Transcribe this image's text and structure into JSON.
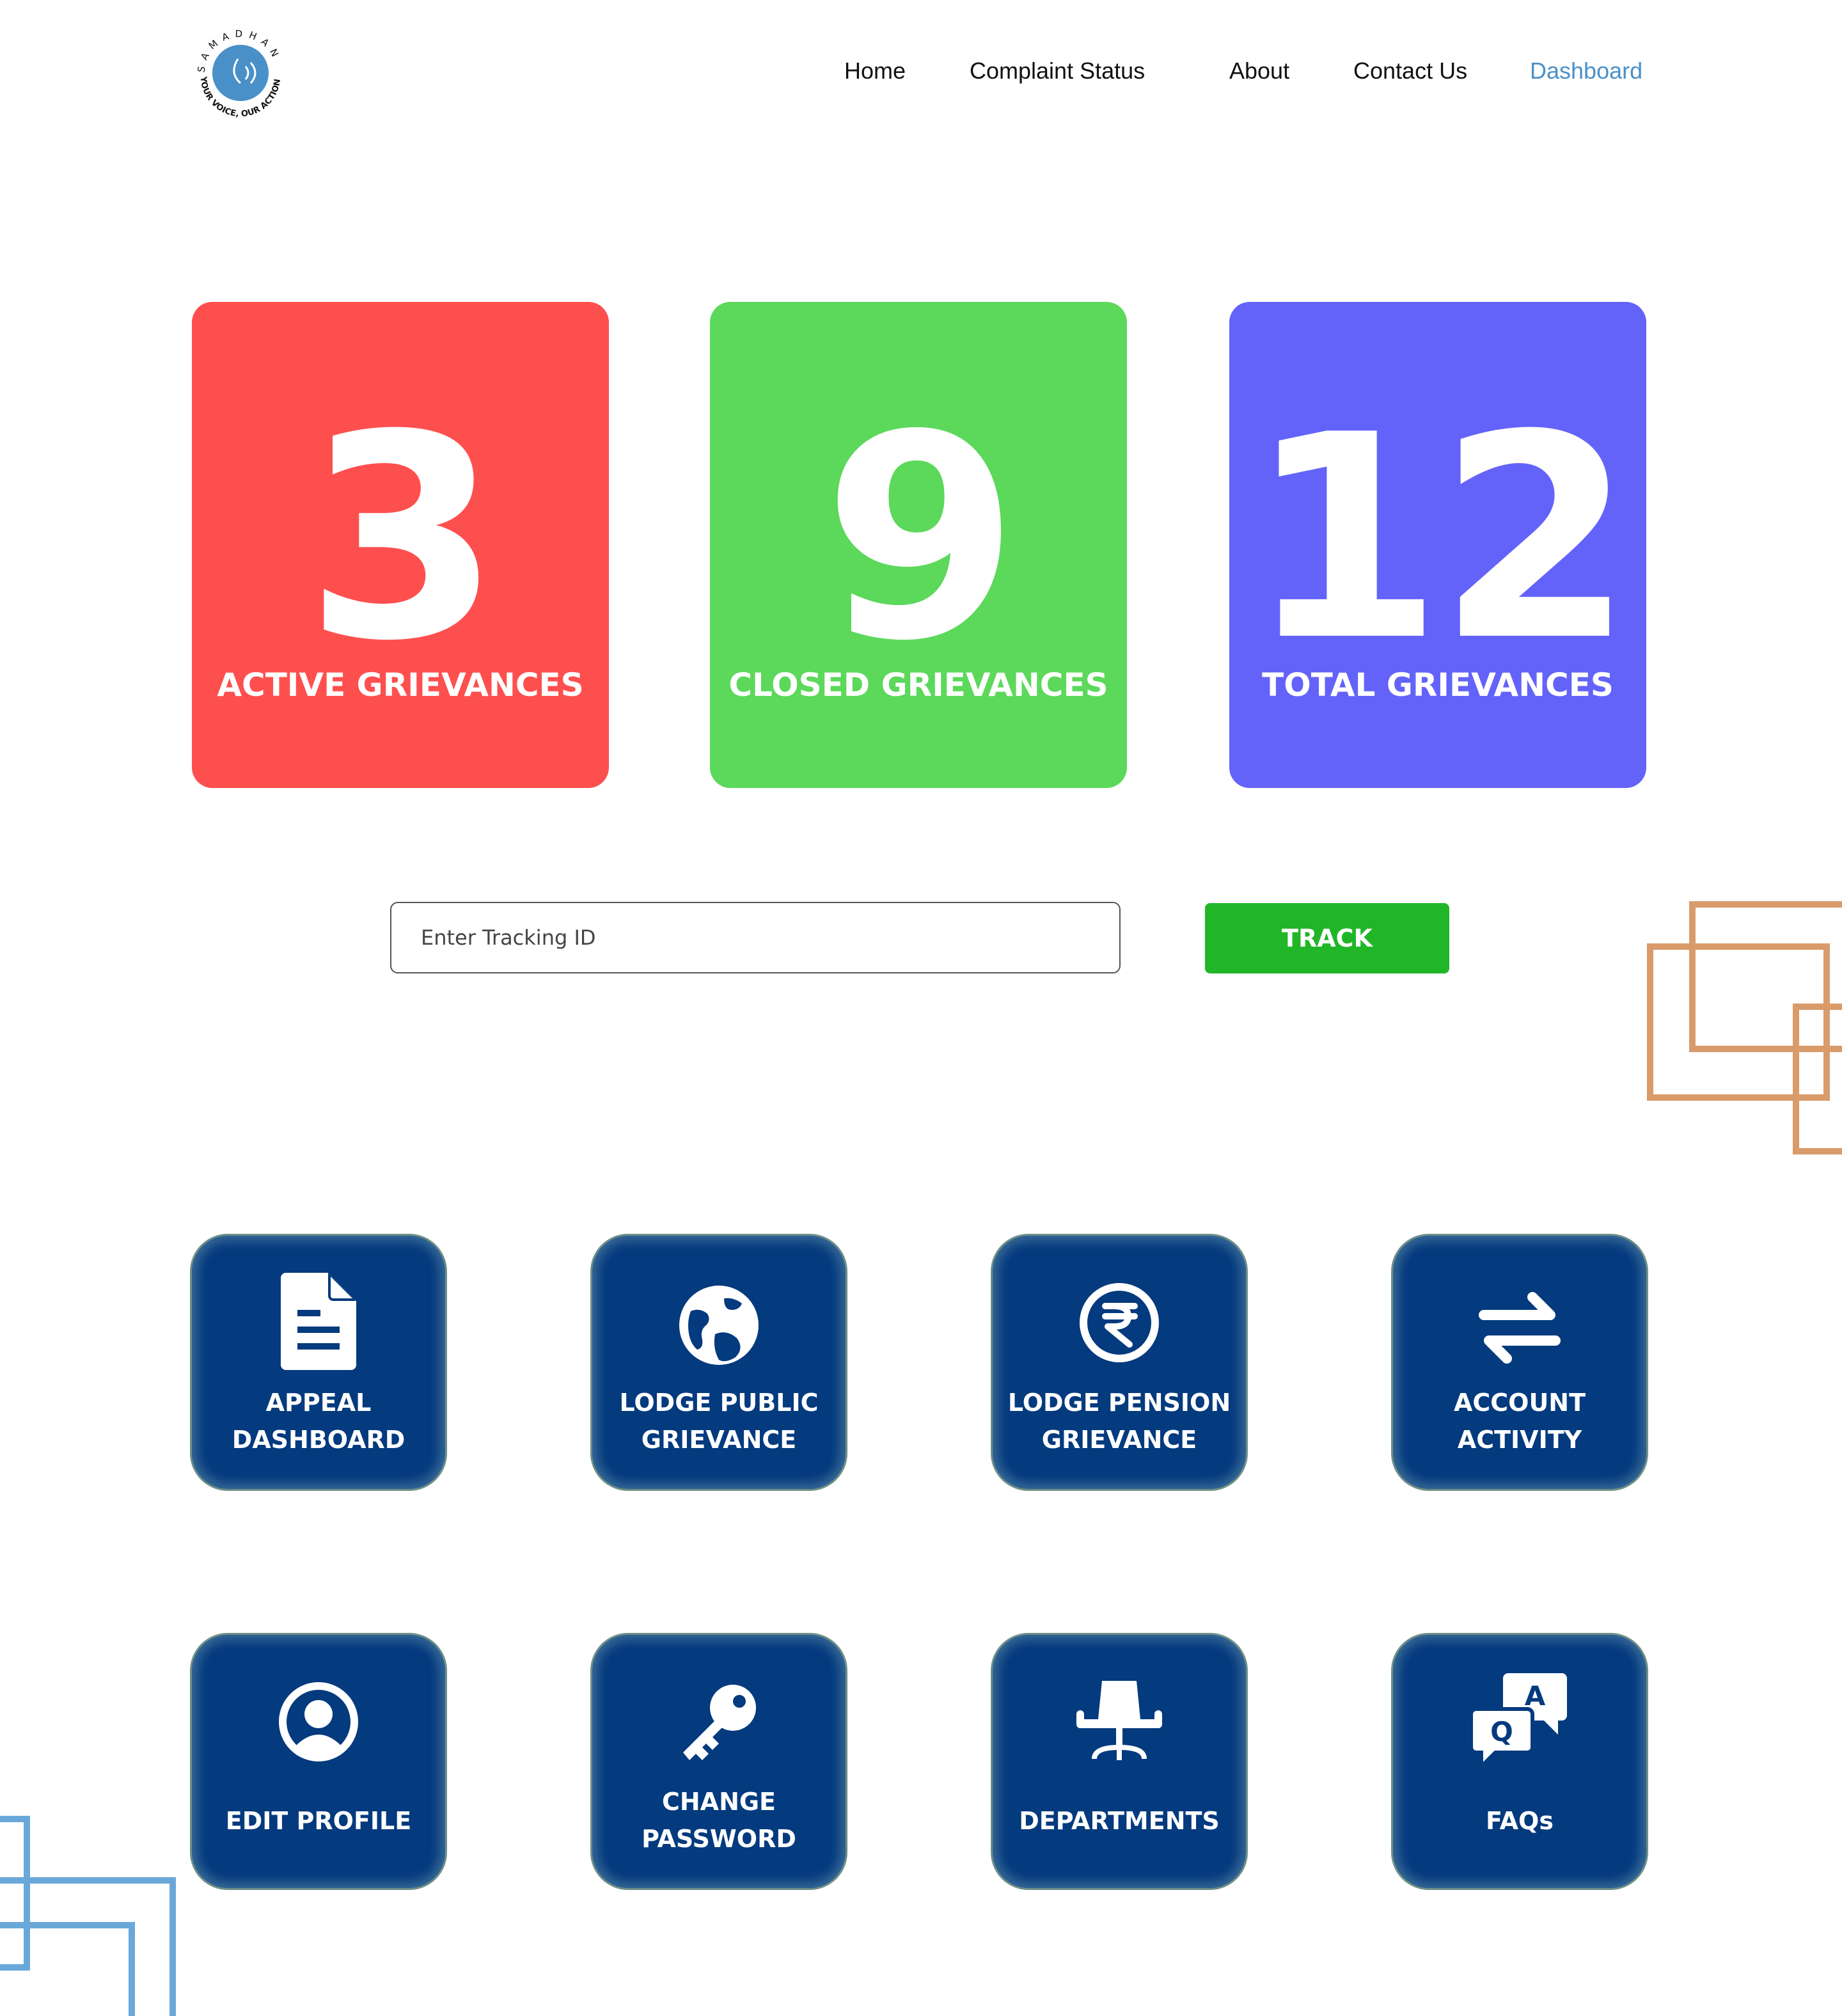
{
  "logo": {
    "text_top": "SAMADHAN",
    "text_bottom": "YOUR VOICE, OUR ACTION",
    "color": "#4a90c8"
  },
  "nav": {
    "items": [
      {
        "label": "Home"
      },
      {
        "label": "Complaint Status"
      },
      {
        "label": "About"
      },
      {
        "label": "Contact Us"
      },
      {
        "label": "Dashboard",
        "active": true
      }
    ]
  },
  "stats": [
    {
      "value": "3",
      "label": "ACTIVE GRIEVANCES",
      "color": "#fe4f4f"
    },
    {
      "value": "9",
      "label": "CLOSED GRIEVANCES",
      "color": "#5cd85b"
    },
    {
      "value": "12",
      "label": "TOTAL GRIEVANCES",
      "color": "#6363fa"
    }
  ],
  "tracking": {
    "placeholder": "Enter Tracking ID",
    "button_label": "TRACK",
    "button_color": "#21b627"
  },
  "tiles": [
    {
      "icon": "document-icon",
      "label_lines": [
        "APPEAL",
        "DASHBOARD"
      ]
    },
    {
      "icon": "globe-icon",
      "label_lines": [
        "LODGE PUBLIC",
        "GRIEVANCE"
      ]
    },
    {
      "icon": "rupee-icon",
      "label_lines": [
        "LODGE PENSION",
        "GRIEVANCE"
      ]
    },
    {
      "icon": "exchange-arrows-icon",
      "label_lines": [
        "ACCOUNT",
        "ACTIVITY"
      ]
    },
    {
      "icon": "user-circle-icon",
      "label_lines": [
        "EDIT PROFILE"
      ]
    },
    {
      "icon": "key-icon",
      "label_lines": [
        "CHANGE",
        "PASSWORD"
      ]
    },
    {
      "icon": "office-chair-icon",
      "label_lines": [
        "DEPARTMENTS"
      ]
    },
    {
      "icon": "faq-bubbles-icon",
      "label_lines": [
        "FAQs"
      ],
      "bubble_letters": [
        "Q",
        "A"
      ]
    }
  ],
  "decor": {
    "orange": "#d99b6a",
    "blue": "#6aa8d9",
    "tile_bg": "#043a7e"
  }
}
